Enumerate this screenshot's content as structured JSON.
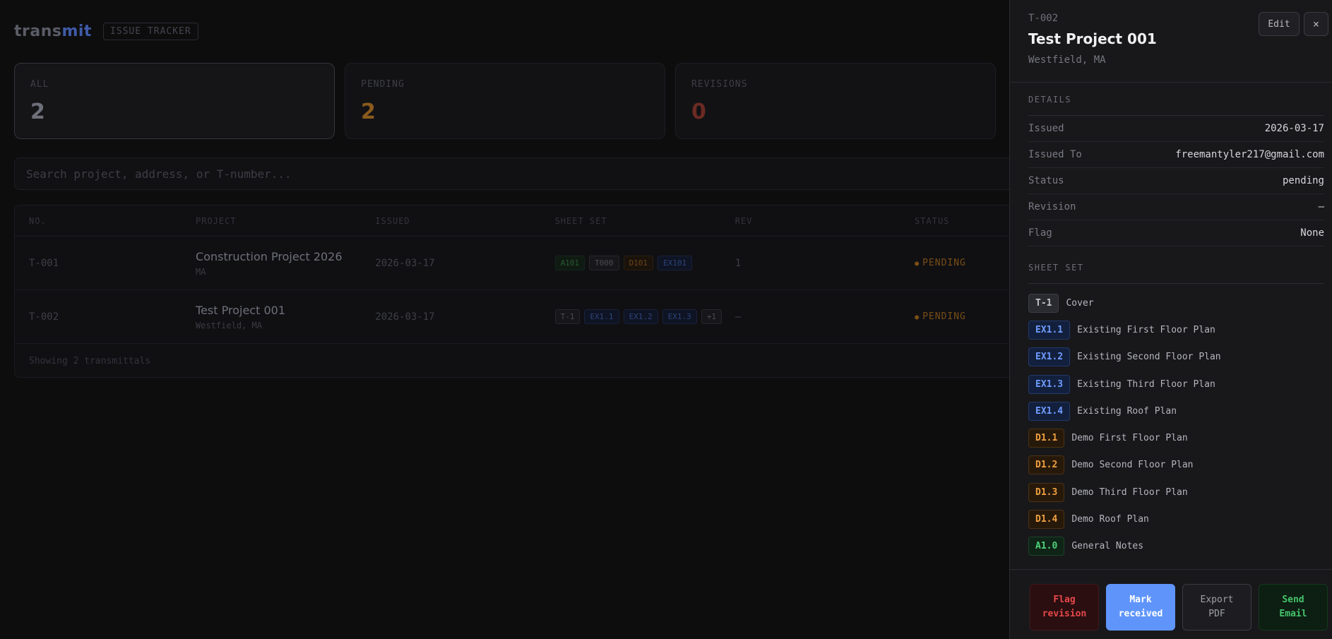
{
  "app": {
    "logo_main": "trans",
    "logo_accent": "mit",
    "tag": "ISSUE TRACKER"
  },
  "stats": [
    {
      "label": "ALL",
      "value": "2"
    },
    {
      "label": "PENDING",
      "value": "2"
    },
    {
      "label": "REVISIONS",
      "value": "0"
    }
  ],
  "search": {
    "placeholder": "Search project, address, or T-number..."
  },
  "table": {
    "headers": [
      "NO.",
      "PROJECT",
      "ISSUED",
      "SHEET SET",
      "REV",
      "STATUS"
    ],
    "rows": [
      {
        "no": "T-001",
        "project": "Construction Project 2026",
        "address": "MA",
        "issued": "2026-03-17",
        "sheets": [
          "A101",
          "T000",
          "D101",
          "EX101"
        ],
        "rev": "1",
        "status": "PENDING"
      },
      {
        "no": "T-002",
        "project": "Test Project 001",
        "address": "Westfield, MA",
        "issued": "2026-03-17",
        "sheets": [
          "T-1",
          "EX1.1",
          "EX1.2",
          "EX1.3",
          "+1"
        ],
        "rev": "—",
        "status": "PENDING"
      }
    ],
    "footer": "Showing 2 transmittals"
  },
  "panel": {
    "number": "T-002",
    "title": "Test Project 001",
    "location": "Westfield, MA",
    "edit_label": "Edit",
    "close_label": "×",
    "details_title": "DETAILS",
    "details": [
      {
        "key": "Issued",
        "value": "2026-03-17"
      },
      {
        "key": "Issued To",
        "value": "freemantyler217@gmail.com"
      },
      {
        "key": "Status",
        "value": "pending"
      },
      {
        "key": "Revision",
        "value": "—"
      },
      {
        "key": "Flag",
        "value": "None"
      }
    ],
    "sheet_title": "SHEET SET",
    "sheets": [
      {
        "code": "T-1",
        "name": "Cover",
        "color": "gray"
      },
      {
        "code": "EX1.1",
        "name": "Existing First Floor Plan",
        "color": "blue"
      },
      {
        "code": "EX1.2",
        "name": "Existing Second Floor Plan",
        "color": "blue"
      },
      {
        "code": "EX1.3",
        "name": "Existing Third Floor Plan",
        "color": "blue"
      },
      {
        "code": "EX1.4",
        "name": "Existing Roof Plan",
        "color": "blue"
      },
      {
        "code": "D1.1",
        "name": "Demo First Floor Plan",
        "color": "orange"
      },
      {
        "code": "D1.2",
        "name": "Demo Second Floor Plan",
        "color": "orange"
      },
      {
        "code": "D1.3",
        "name": "Demo Third Floor Plan",
        "color": "orange"
      },
      {
        "code": "D1.4",
        "name": "Demo Roof Plan",
        "color": "orange"
      },
      {
        "code": "A1.0",
        "name": "General Notes",
        "color": "green"
      }
    ],
    "actions": {
      "flag": "Flag\nrevision",
      "mark": "Mark\nreceived",
      "export": "Export\nPDF",
      "send": "Send\nEmail"
    }
  },
  "colors": {
    "accent_blue": "#5f95fb",
    "danger": "#e8484a",
    "success": "#46c46c",
    "pending": "#f0a040"
  }
}
